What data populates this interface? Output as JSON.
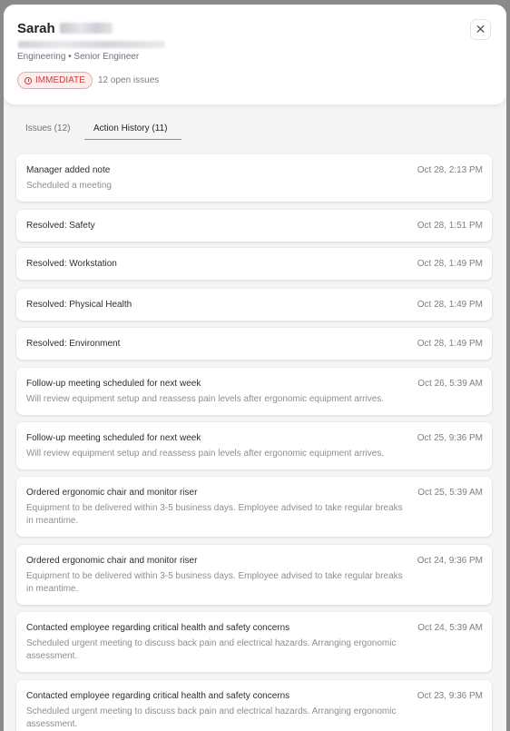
{
  "header": {
    "first_name": "Sarah",
    "subtitle": "Engineering • Senior Engineer",
    "priority_badge": "IMMEDIATE",
    "open_issues": "12 open issues",
    "close_symbol": "✕"
  },
  "tabs": [
    {
      "label": "Issues (12)",
      "active": false
    },
    {
      "label": "Action History (11)",
      "active": true
    }
  ],
  "history": [
    {
      "title": "Manager added note",
      "time": "Oct 28, 2:13 PM",
      "desc": "Scheduled a meeting"
    },
    {
      "title": "Resolved: Safety",
      "time": "Oct 28, 1:51 PM",
      "desc": ""
    },
    {
      "title": "Resolved: Workstation",
      "time": "Oct 28, 1:49 PM",
      "desc": ""
    },
    {
      "title": "Resolved: Physical Health",
      "time": "Oct 28, 1:49 PM",
      "desc": ""
    },
    {
      "title": "Resolved: Environment",
      "time": "Oct 28, 1:49 PM",
      "desc": ""
    },
    {
      "title": "Follow-up meeting scheduled for next week",
      "time": "Oct 26, 5:39 AM",
      "desc": "Will review equipment setup and reassess pain levels after ergonomic equipment arrives."
    },
    {
      "title": "Follow-up meeting scheduled for next week",
      "time": "Oct 25, 9:36 PM",
      "desc": "Will review equipment setup and reassess pain levels after ergonomic equipment arrives."
    },
    {
      "title": "Ordered ergonomic chair and monitor riser",
      "time": "Oct 25, 5:39 AM",
      "desc": "Equipment to be delivered within 3-5 business days. Employee advised to take regular breaks in meantime."
    },
    {
      "title": "Ordered ergonomic chair and monitor riser",
      "time": "Oct 24, 9:36 PM",
      "desc": "Equipment to be delivered within 3-5 business days. Employee advised to take regular breaks in meantime."
    },
    {
      "title": "Contacted employee regarding critical health and safety concerns",
      "time": "Oct 24, 5:39 AM",
      "desc": "Scheduled urgent meeting to discuss back pain and electrical hazards. Arranging ergonomic assessment."
    },
    {
      "title": "Contacted employee regarding critical health and safety concerns",
      "time": "Oct 23, 9:36 PM",
      "desc": "Scheduled urgent meeting to discuss back pain and electrical hazards. Arranging ergonomic assessment."
    }
  ]
}
